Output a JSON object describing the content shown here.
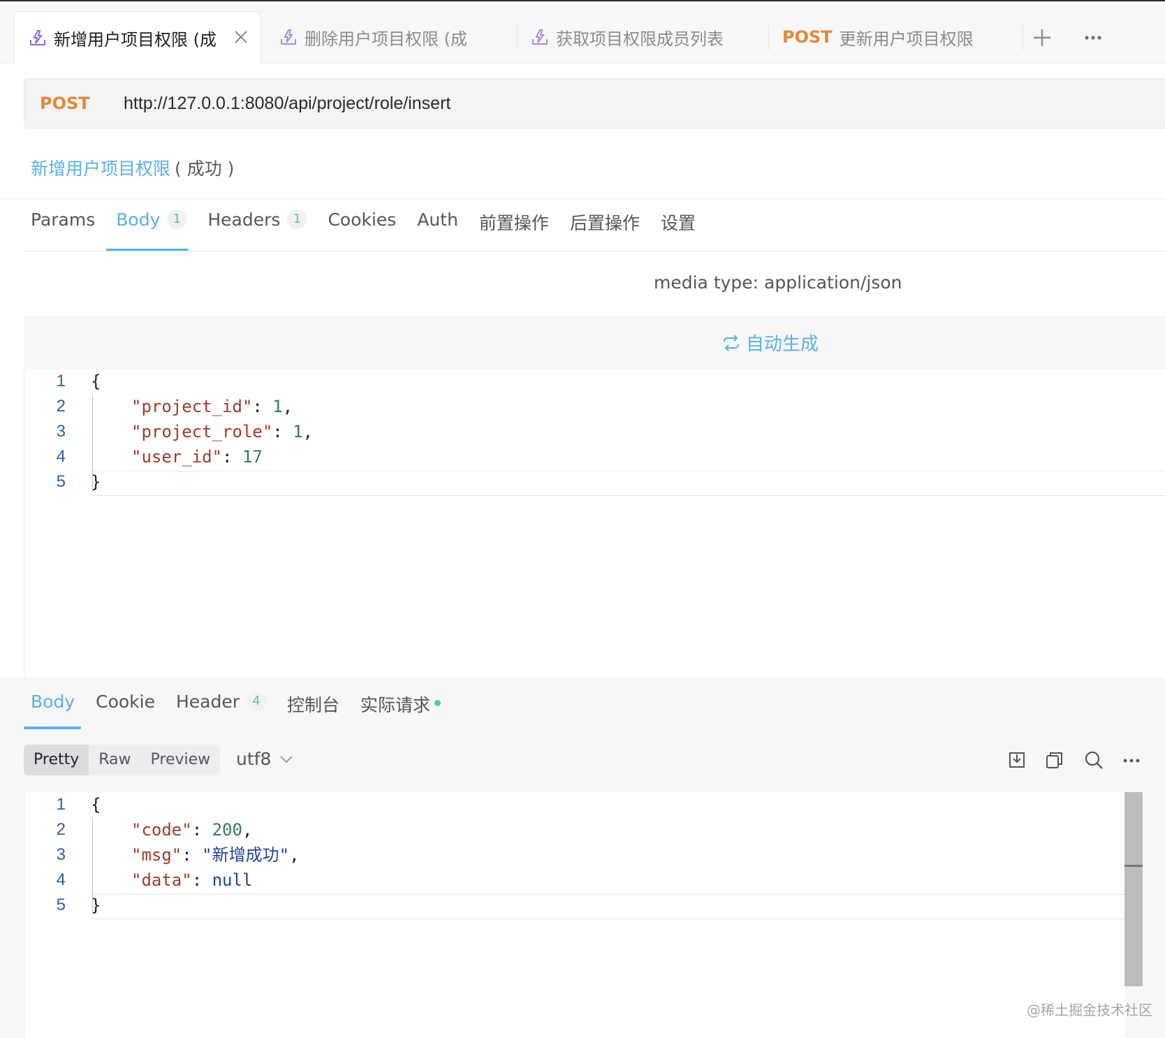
{
  "tabs": [
    {
      "label": "新增用户项目权限 (成",
      "method": ""
    },
    {
      "label": "删除用户项目权限 (成",
      "method": ""
    },
    {
      "label": "获取项目权限成员列表",
      "method": ""
    },
    {
      "label": "更新用户项目权限",
      "method": "POST"
    }
  ],
  "request": {
    "method": "POST",
    "url": "http://127.0.0.1:8080/api/project/role/insert",
    "name": "新增用户项目权限",
    "status": "( 成功 )"
  },
  "request_tabs": [
    {
      "label": "Params",
      "badge": ""
    },
    {
      "label": "Body",
      "badge": "1"
    },
    {
      "label": "Headers",
      "badge": "1"
    },
    {
      "label": "Cookies",
      "badge": ""
    },
    {
      "label": "Auth",
      "badge": ""
    },
    {
      "label": "前置操作",
      "badge": ""
    },
    {
      "label": "后置操作",
      "badge": ""
    },
    {
      "label": "设置",
      "badge": ""
    }
  ],
  "media_type": "media type: application/json",
  "auto_generate": "自动生成",
  "request_body_lines": [
    "1",
    "2",
    "3",
    "4",
    "5"
  ],
  "request_body": {
    "open": "{",
    "k1": "\"project_id\"",
    "v1": "1",
    "k2": "\"project_role\"",
    "v2": "1",
    "k3": "\"user_id\"",
    "v3": "17",
    "close": "}"
  },
  "response_tabs": [
    {
      "label": "Body",
      "badge": ""
    },
    {
      "label": "Cookie",
      "badge": ""
    },
    {
      "label": "Header",
      "badge": "4"
    },
    {
      "label": "控制台",
      "badge": ""
    },
    {
      "label": "实际请求",
      "badge": ""
    }
  ],
  "view_modes": [
    "Pretty",
    "Raw",
    "Preview"
  ],
  "encoding": "utf8",
  "response_body": {
    "open": "{",
    "k1": "\"code\"",
    "v1": "200",
    "k2": "\"msg\"",
    "v2": "\"新增成功\"",
    "k3": "\"data\"",
    "v3": "null",
    "close": "}"
  },
  "watermark": "@稀土掘金技术社区",
  "colors": {
    "accent": "#5ab0e4",
    "post": "#e08a3a",
    "badge_text": "#59c3a4",
    "status_dot": "#4ccf9a"
  }
}
